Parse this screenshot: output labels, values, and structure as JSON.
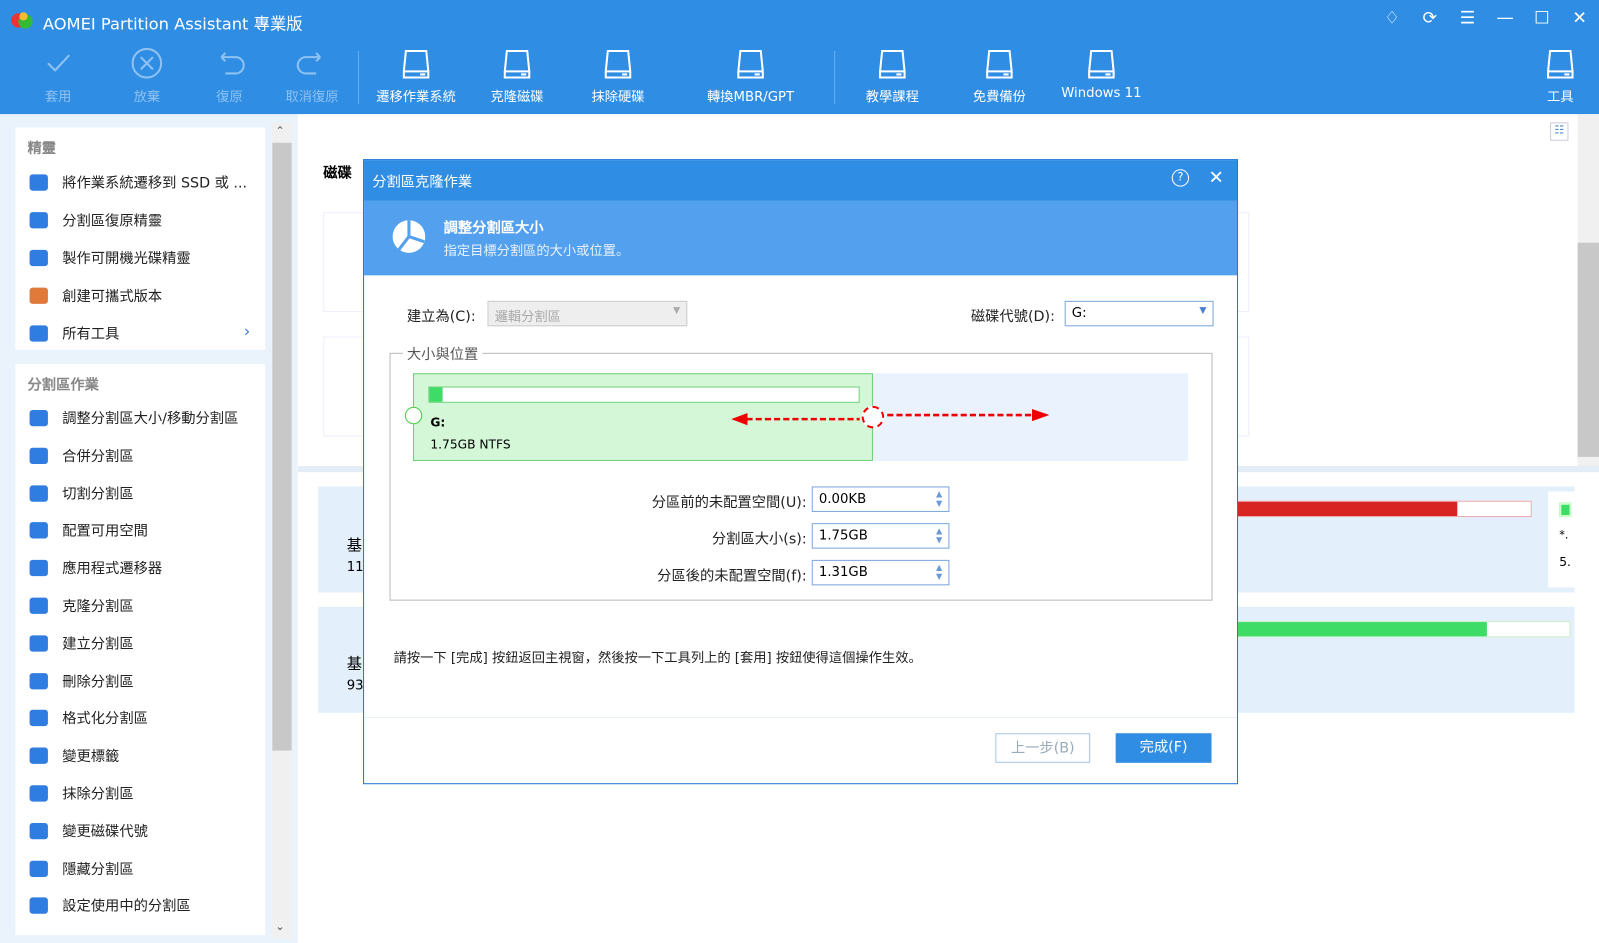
{
  "app": {
    "title": "AOMEI Partition Assistant 專業版"
  },
  "toolbar": [
    {
      "label": "套用",
      "icon": "check-icon",
      "enabled": false
    },
    {
      "label": "放棄",
      "icon": "discard-icon",
      "enabled": false
    },
    {
      "label": "復原",
      "icon": "undo-icon",
      "enabled": false
    },
    {
      "label": "取消復原",
      "icon": "redo-icon",
      "enabled": false
    },
    {
      "label": "遷移作業系統",
      "icon": "migrate-os-icon",
      "enabled": true
    },
    {
      "label": "克隆磁碟",
      "icon": "clone-disk-icon",
      "enabled": true
    },
    {
      "label": "抹除硬碟",
      "icon": "wipe-disk-icon",
      "enabled": true
    },
    {
      "label": "轉換MBR/GPT",
      "icon": "convert-icon",
      "enabled": true
    },
    {
      "label": "教學課程",
      "icon": "tutorial-icon",
      "enabled": true
    },
    {
      "label": "免費備份",
      "icon": "backup-icon",
      "enabled": true
    },
    {
      "label": "Windows 11",
      "icon": "windows11-icon",
      "enabled": true
    },
    {
      "label": "工具",
      "icon": "tools-icon",
      "enabled": true
    }
  ],
  "sidebar": {
    "wizards": {
      "title": "精靈",
      "items": [
        "將作業系統遷移到 SSD 或 ...",
        "分割區復原精靈",
        "製作可開機光碟精靈",
        "創建可攜式版本",
        "所有工具"
      ]
    },
    "operations": {
      "title": "分割區作業",
      "items": [
        "調整分割區大小/移動分割區",
        "合併分割區",
        "切割分割區",
        "配置可用空間",
        "應用程式遷移器",
        "克隆分割區",
        "建立分割區",
        "刪除分割區",
        "格式化分割區",
        "變更標籤",
        "抹除分割區",
        "變更磁碟代號",
        "隱藏分割區",
        "設定使用中的分割區"
      ]
    }
  },
  "main": {
    "disk_header": "磁碟",
    "disk1_label": "基",
    "disk1_size": "11",
    "disk2_label": "基",
    "disk2_size": "93",
    "side_a": "*.",
    "side_b": "5."
  },
  "dialog": {
    "title": "分割區克隆作業",
    "banner_title": "調整分割區大小",
    "banner_sub": "指定目標分割區的大小或位置。",
    "create_as_label": "建立為(C):",
    "create_as_value": "邏輯分割區",
    "drive_letter_label": "磁碟代號(D):",
    "drive_letter_value": "G:",
    "group_title": "大小與位置",
    "partition_name": "G:",
    "partition_info": "1.75GB NTFS",
    "used_fraction": 0.03,
    "before_label": "分區前的未配置空間(U):",
    "before_value": "0.00KB",
    "size_label": "分割區大小(s):",
    "size_value": "1.75GB",
    "after_label": "分區後的未配置空間(f):",
    "after_value": "1.31GB",
    "hint": "請按一下 [完成] 按鈕返回主視窗，然後按一下工具列上的 [套用] 按鈕使得這個操作生效。",
    "back_button": "上一步(B)",
    "finish_button": "完成(F)"
  }
}
